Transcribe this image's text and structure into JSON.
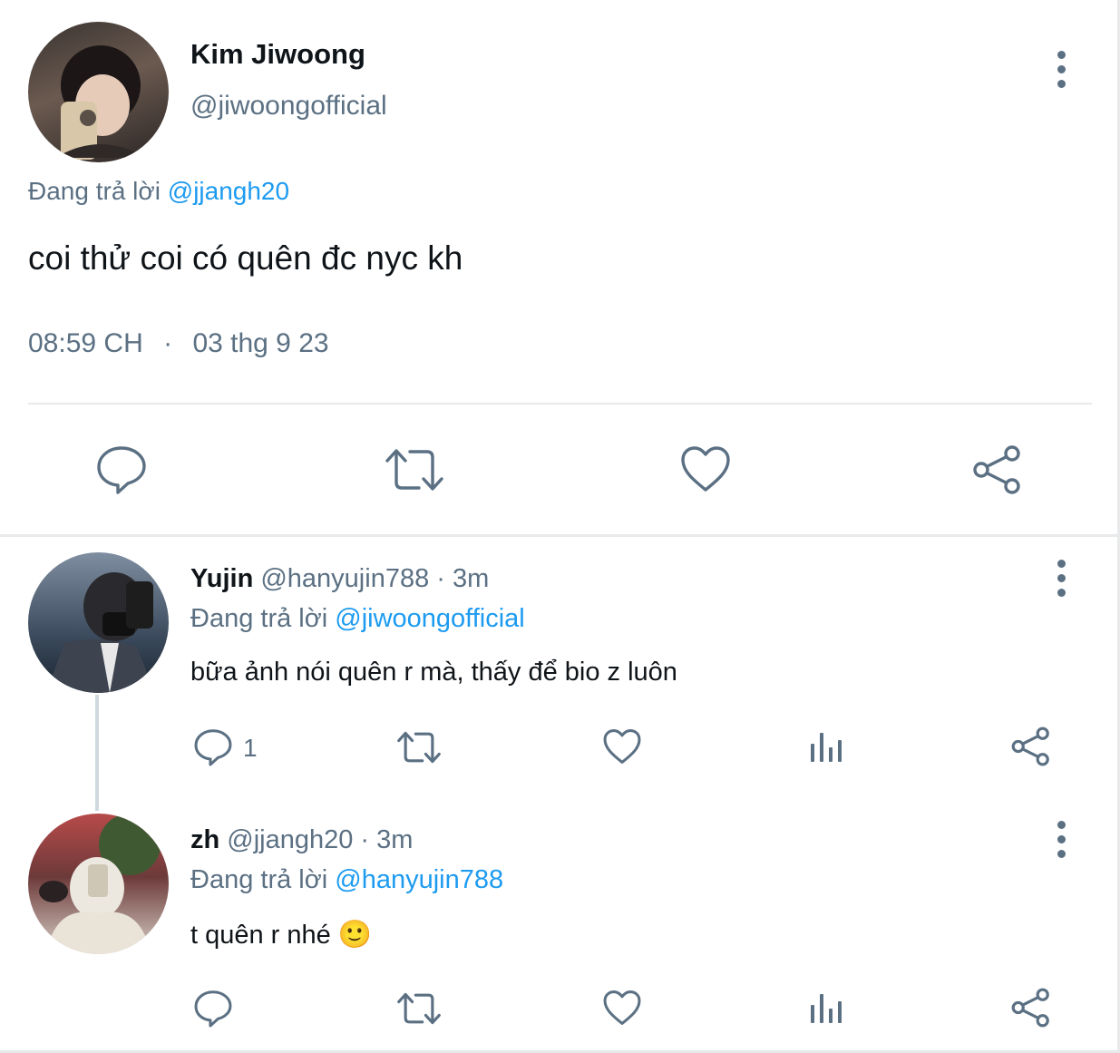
{
  "main_tweet": {
    "author_name": "Kim Jiwoong",
    "author_handle": "@jiwoongofficial",
    "replying_prefix": "Đang trả lời",
    "replying_to": "@jjangh20",
    "text": "coi thử coi có quên đc nyc kh",
    "time": "08:59 CH",
    "separator": "·",
    "date": "03 thg 9 23"
  },
  "replies": [
    {
      "author_name": "Yujin",
      "author_meta": "@hanyujin788 · 3m",
      "replying_prefix": "Đang trả lời",
      "replying_to": "@jiwoongofficial",
      "text": "bữa ảnh nói quên r mà, thấy để bio z luôn",
      "reply_count": "1"
    },
    {
      "author_name": "zh",
      "author_meta": "@jjangh20 · 3m",
      "replying_prefix": "Đang trả lời",
      "replying_to": "@hanyujin788",
      "text": "t quên r nhé",
      "emoji": "🙂"
    }
  ],
  "colors": {
    "text": "#0f1419",
    "secondary": "#5b7083",
    "link": "#1d9bf0",
    "divider": "#e7e9ea"
  }
}
